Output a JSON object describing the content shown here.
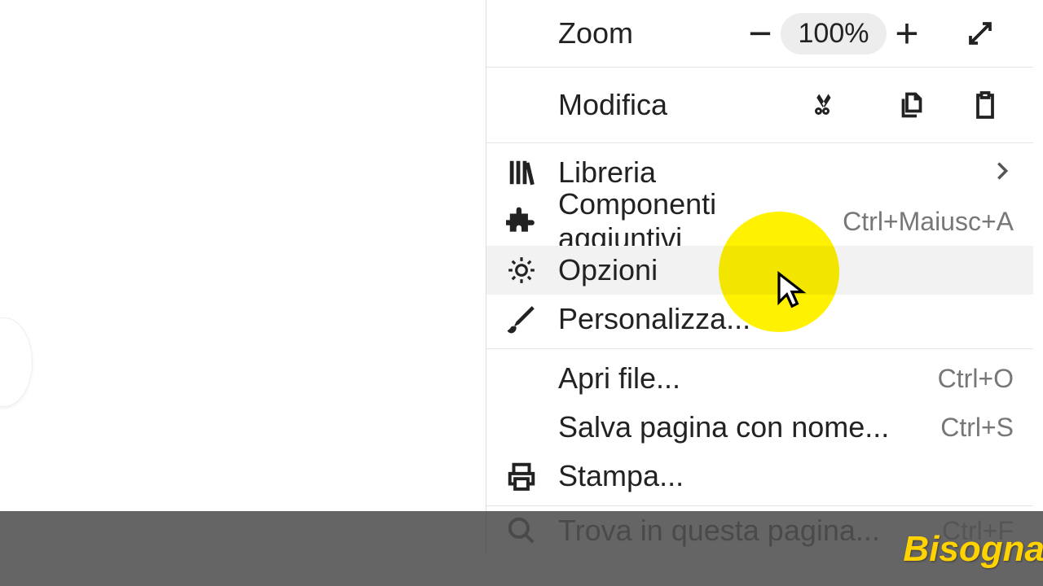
{
  "zoom": {
    "label": "Zoom",
    "value": "100%"
  },
  "edit": {
    "label": "Modifica"
  },
  "items": {
    "library": {
      "label": "Libreria"
    },
    "addons": {
      "label": "Componenti aggiuntivi",
      "shortcut": "Ctrl+Maiusc+A"
    },
    "options": {
      "label": "Opzioni"
    },
    "customize": {
      "label": "Personalizza..."
    },
    "open_file": {
      "label": "Apri file...",
      "shortcut": "Ctrl+O"
    },
    "save_as": {
      "label": "Salva pagina con nome...",
      "shortcut": "Ctrl+S"
    },
    "print": {
      "label": "Stampa..."
    },
    "find": {
      "label": "Trova in questa pagina...",
      "shortcut": "Ctrl+F"
    }
  },
  "subtitle": "Bisogna"
}
